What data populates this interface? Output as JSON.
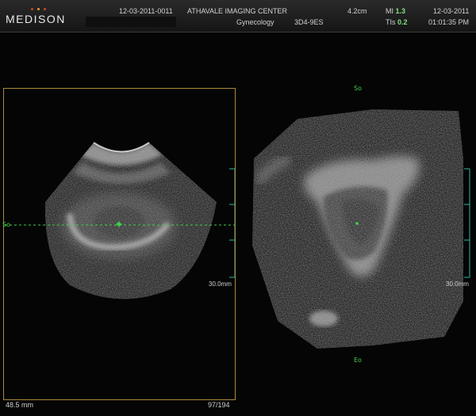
{
  "header": {
    "brand": "MEDISON",
    "exam_id": "12-03-2011-0011",
    "institution": "ATHAVALE IMAGING CENTER",
    "department": "Gynecology",
    "depth": "4.2cm",
    "probe": "3D4-9ES",
    "mi_label": "MI",
    "mi_value": "1.3",
    "tis_label": "TIs",
    "tis_value": "0.2",
    "date": "12-03-2011",
    "time": "01:01:35 PM"
  },
  "markers": {
    "start_left": "So",
    "start_right": "So",
    "end_right": "Eo"
  },
  "scales": {
    "left_depth": "30.0mm",
    "right_depth": "30.0mm"
  },
  "footer": {
    "measurement": "48.5 mm",
    "frame_counter": "97/194"
  },
  "colors": {
    "accent_green": "#3fd04a",
    "frame_gold": "#a88a3a",
    "scale_teal": "#2fb8a8",
    "logo_dots": [
      "#d84030",
      "#e8a020",
      "#d84030"
    ]
  }
}
